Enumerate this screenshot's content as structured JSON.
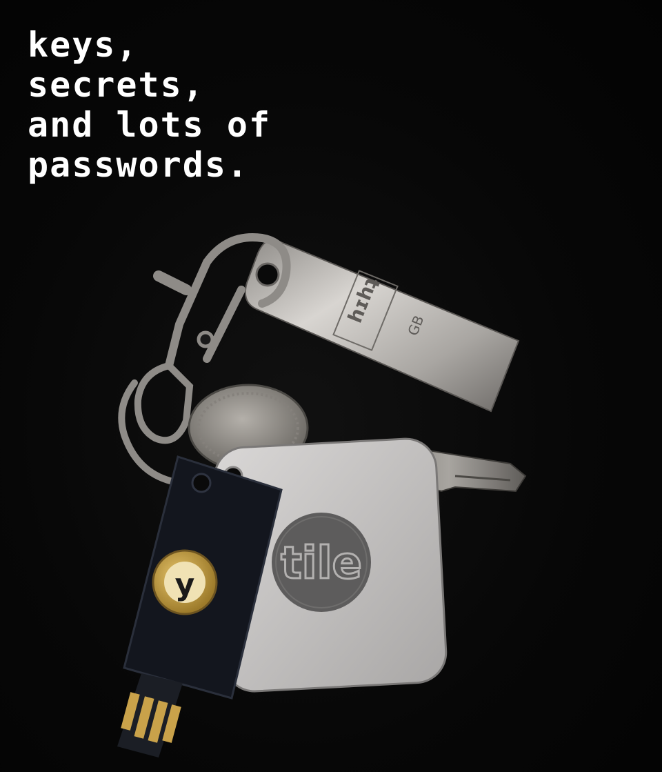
{
  "caption": {
    "line1": "keys,",
    "line2": "secrets,",
    "line3": "and lots of",
    "line4": "passwords."
  },
  "objects": {
    "usb_drive": {
      "brand_text": "hɪhʇ",
      "capacity_text": "GB",
      "icon": "usb-flash-drive"
    },
    "tile_tracker": {
      "logo_text": "tile",
      "icon": "tile-tracker"
    },
    "security_key": {
      "logo_text": "y",
      "icon": "yubikey-security-key"
    },
    "coin": {
      "icon": "coin"
    },
    "house_key": {
      "icon": "metal-key"
    },
    "carabiner": {
      "icon": "lobster-clasp"
    }
  },
  "colors": {
    "background": "#050505",
    "caption_text": "#ffffff",
    "usb_metal": "#b9b6b2",
    "tile_body": "#c9c7c6",
    "tile_logo_circle": "#5a5a5a",
    "yubikey_body": "#14171f",
    "yubikey_gold": "#c9a24a"
  }
}
